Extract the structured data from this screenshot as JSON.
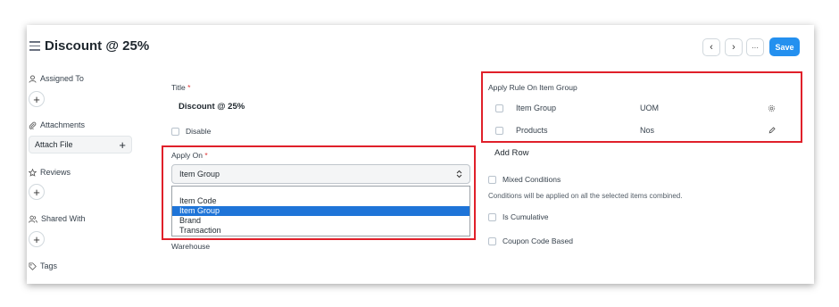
{
  "header": {
    "title": "Discount @ 25%",
    "prev_icon": "‹",
    "next_icon": "›",
    "more_icon": "···",
    "save_label": "Save"
  },
  "sidebar": {
    "assigned_to": "Assigned To",
    "attachments": "Attachments",
    "attach_file": "Attach File",
    "reviews": "Reviews",
    "shared_with": "Shared With",
    "tags": "Tags"
  },
  "form": {
    "title_label": "Title",
    "title_value": "Discount @ 25%",
    "disable_label": "Disable",
    "apply_on_label": "Apply On",
    "apply_on_value": "Item Group",
    "apply_on_options": [
      "Item Code",
      "Item Group",
      "Brand",
      "Transaction"
    ],
    "warehouse_label": "Warehouse",
    "required_mark": "*"
  },
  "rule_table": {
    "title": "Apply Rule On Item Group",
    "header": {
      "item_group": "Item Group",
      "uom": "UOM"
    },
    "rows": [
      {
        "item_group": "Products",
        "uom": "Nos"
      }
    ],
    "add_row": "Add Row"
  },
  "options": {
    "mixed_conditions": "Mixed Conditions",
    "mixed_conditions_hint": "Conditions will be applied on all the selected items combined.",
    "is_cumulative": "Is Cumulative",
    "coupon_code_based": "Coupon Code Based"
  },
  "colors": {
    "accent": "#2490ef",
    "highlight_border": "#e0202a",
    "selected_option": "#1e74d8"
  }
}
